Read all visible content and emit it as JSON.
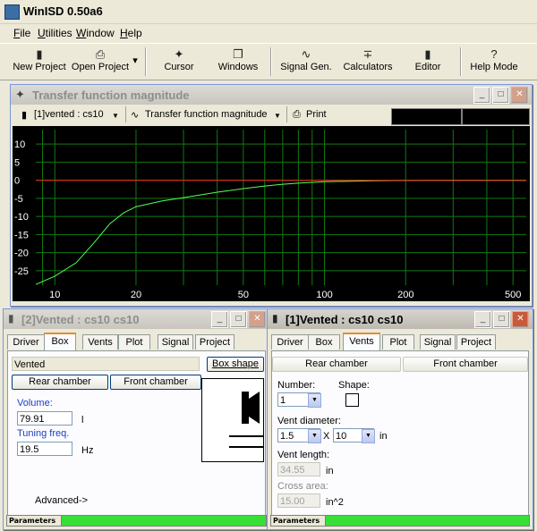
{
  "app": {
    "title": "WinISD 0.50a6"
  },
  "menu": [
    {
      "label": "File",
      "u": "F",
      "rest": "ile"
    },
    {
      "label": "Utilities",
      "u": "U",
      "rest": "tilities"
    },
    {
      "label": "Window",
      "u": "W",
      "rest": "indow"
    },
    {
      "label": "Help",
      "u": "H",
      "rest": "elp"
    }
  ],
  "toolbar": {
    "new_project": "New Project",
    "open_project": "Open Project",
    "cursor": "Cursor",
    "windows": "Windows",
    "signal_gen": "Signal Gen.",
    "calculators": "Calculators",
    "editor": "Editor",
    "help_mode": "Help Mode"
  },
  "transfer_window": {
    "title": "Transfer function magnitude",
    "project_select": "[1]vented : cs10",
    "plot_type": "Transfer function magnitude",
    "print": "Print"
  },
  "chart_data": {
    "type": "line",
    "xscale": "log",
    "xlim": [
      8.5,
      560
    ],
    "ylim": [
      -29,
      14
    ],
    "xticks": [
      10,
      20,
      50,
      100,
      200,
      500
    ],
    "yticks": [
      10,
      5,
      0,
      -5,
      -10,
      -15,
      -20,
      -25
    ],
    "grid": true,
    "series": [
      {
        "color": "#55ff55",
        "x": [
          8.5,
          10,
          12,
          14,
          16,
          18,
          20,
          25,
          30,
          40,
          50,
          60,
          70,
          80,
          100,
          150,
          200,
          300,
          400,
          560
        ],
        "y": [
          -28.8,
          -26.5,
          -22.8,
          -17.2,
          -12.0,
          -9.0,
          -7.3,
          -5.7,
          -4.8,
          -3.3,
          -2.3,
          -1.6,
          -1.1,
          -0.8,
          -0.4,
          -0.15,
          -0.05,
          0,
          0,
          0
        ]
      },
      {
        "color": "#ff2020",
        "x": [
          8.5,
          560
        ],
        "y": [
          0,
          0
        ]
      }
    ]
  },
  "vented2": {
    "title": "[2]Vented : cs10 cs10",
    "tabs": [
      "Driver",
      "Box",
      "Vents",
      "Plot",
      "Signal",
      "Project"
    ],
    "box_type": "Vented",
    "box_shape_btn": "Box shape",
    "rear_chamber": "Rear chamber",
    "front_chamber": "Front chamber",
    "volume_label": "Volume:",
    "volume_value": "79.91",
    "volume_unit": "l",
    "tuning_label": "Tuning freq.",
    "tuning_value": "19.5",
    "tuning_unit": "Hz",
    "advanced": "Advanced->",
    "status_label": "Parameters"
  },
  "vented1": {
    "title": "[1]Vented : cs10 cs10",
    "tabs": [
      "Driver",
      "Box",
      "Vents",
      "Plot",
      "Signal",
      "Project"
    ],
    "rear_chamber": "Rear chamber",
    "front_chamber": "Front chamber",
    "number_label": "Number:",
    "number_value": "1",
    "shape_label": "Shape:",
    "diameter_label": "Vent diameter:",
    "diameter_value": "1.5",
    "diameter_x": "X",
    "diameter_value2": "10",
    "diameter_unit": "in",
    "length_label": "Vent length:",
    "length_value": "34.55",
    "length_unit": "in",
    "cross_label": "Cross area:",
    "cross_value": "15.00",
    "cross_unit": "in^2",
    "status_label": "Parameters"
  }
}
